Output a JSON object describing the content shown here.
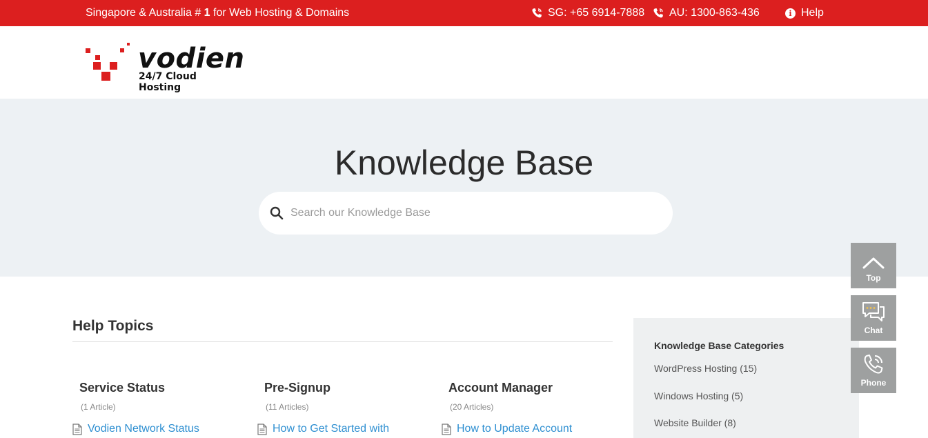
{
  "topbar": {
    "tagline_prefix": "Singapore & Australia # ",
    "tagline_rank": "1",
    "tagline_suffix": " for Web Hosting & Domains",
    "sg_phone": "SG: +65 6914-7888",
    "au_phone": "AU: 1300-863-436",
    "help_label": "Help"
  },
  "logo": {
    "brand": "vodien",
    "tagline": "24/7 Cloud Hosting"
  },
  "hero": {
    "title": "Knowledge Base",
    "search_placeholder": "Search our Knowledge Base"
  },
  "help_topics": {
    "title": "Help Topics",
    "topics": [
      {
        "title": "Service Status",
        "count": "(1 Article)",
        "link": "Vodien Network Status"
      },
      {
        "title": "Pre-Signup",
        "count": "(11 Articles)",
        "link": "How to Get Started with"
      },
      {
        "title": "Account Manager",
        "count": "(20 Articles)",
        "link": "How to Update Account"
      }
    ]
  },
  "categories": {
    "title": "Knowledge Base Categories",
    "items": [
      {
        "label": "WordPress Hosting (15)"
      },
      {
        "label": "Windows Hosting (5)"
      },
      {
        "label": "Website Builder (8)"
      }
    ]
  },
  "float_buttons": {
    "top": "Top",
    "chat": "Chat",
    "phone": "Phone"
  },
  "colors": {
    "brand_red": "#dc1f1f",
    "link_blue": "#2e8fd1",
    "hero_bg": "#edf1f4",
    "float_gray": "#9ea0a0"
  }
}
